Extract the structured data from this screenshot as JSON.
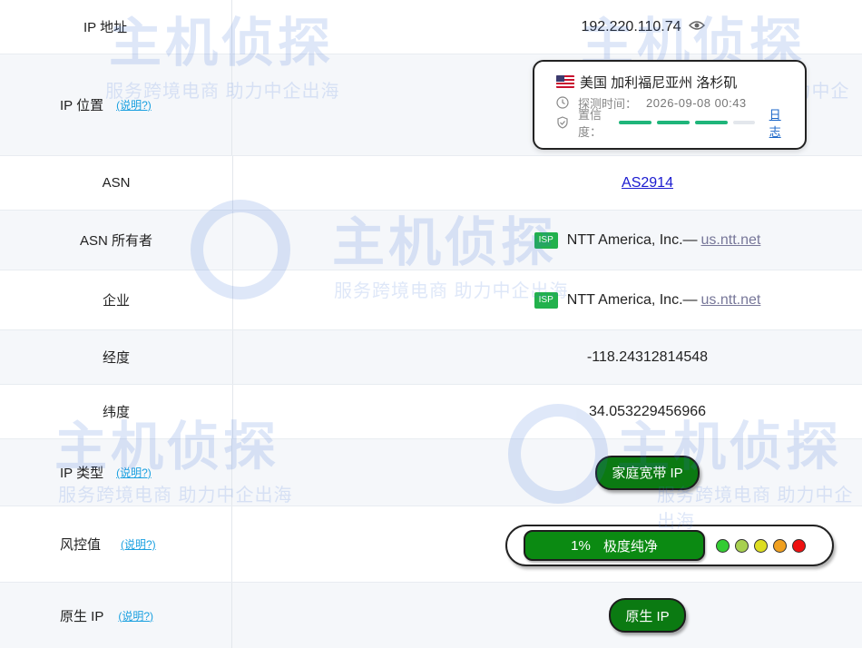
{
  "rows": {
    "ip": {
      "label": "IP 地址",
      "value": "192.220.110.74",
      "icon": "eye-icon"
    },
    "location": {
      "label": "IP 位置",
      "explain": "(说明?)",
      "country_region": "美国 加利福尼亚州 洛杉矶",
      "flag": "us-flag-icon",
      "detect_label": "探测时间：",
      "detect_time": "2026-09-08 00:43",
      "confidence_label": "置信度：",
      "confidence_level": 0.8,
      "log_link": "日志"
    },
    "asn": {
      "label": "ASN",
      "value": "AS2914"
    },
    "asn_owner": {
      "label": "ASN 所有者",
      "badge": "ISP",
      "org": "NTT America, Inc.—",
      "site": "us.ntt.net"
    },
    "company": {
      "label": "企业",
      "badge": "ISP",
      "org": "NTT America, Inc.—",
      "site": "us.ntt.net"
    },
    "longitude": {
      "label": "经度",
      "value": "-118.24312814548"
    },
    "latitude": {
      "label": "纬度",
      "value": "34.053229456966"
    },
    "ip_type": {
      "label": "IP 类型",
      "explain": "(说明?)",
      "value": "家庭宽带 IP"
    },
    "risk": {
      "label": "风控值",
      "explain": "(说明?)",
      "percent": "1%",
      "text": "极度纯净",
      "dot_colors": [
        "#33cc33",
        "#a8d050",
        "#dddd22",
        "#f0a020",
        "#ee1111"
      ]
    },
    "native_ip": {
      "label": "原生 IP",
      "explain": "(说明?)",
      "value": "原生 IP"
    }
  },
  "watermark": {
    "brand": "主机侦探",
    "slogan": "服务跨境电商 助力中企出海"
  },
  "colors": {
    "green_button": "#0b7a12",
    "link_blue": "#1a1ad0",
    "explain_blue": "#1aa0e0",
    "isp_green": "#22b14c"
  }
}
